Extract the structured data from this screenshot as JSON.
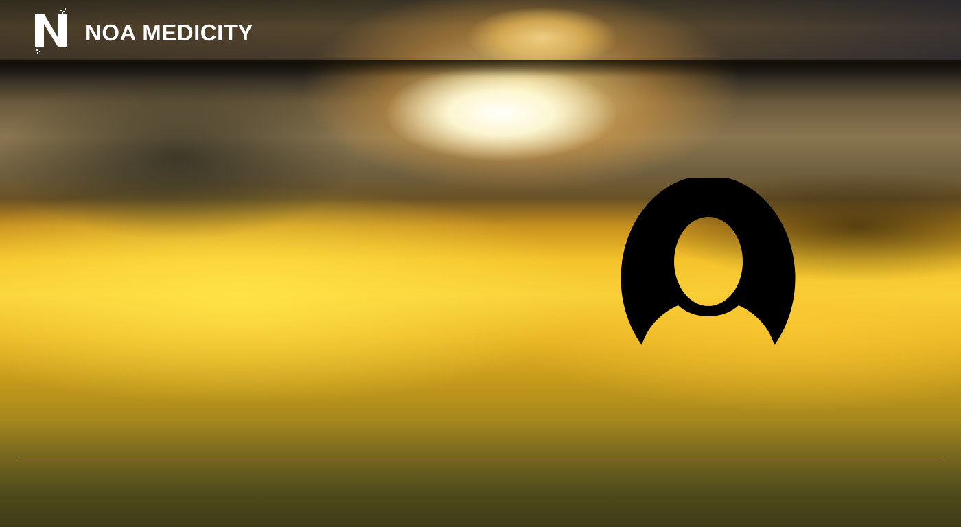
{
  "header": {
    "brand_name": "NOA MEDICITY",
    "logo_icon": "noa-n-logo-icon"
  },
  "main": {
    "avatar_icon": "user-avatar-icon"
  },
  "colors": {
    "brand_text": "#ffffff",
    "avatar": "#000000",
    "divider": "#1a1a10"
  }
}
